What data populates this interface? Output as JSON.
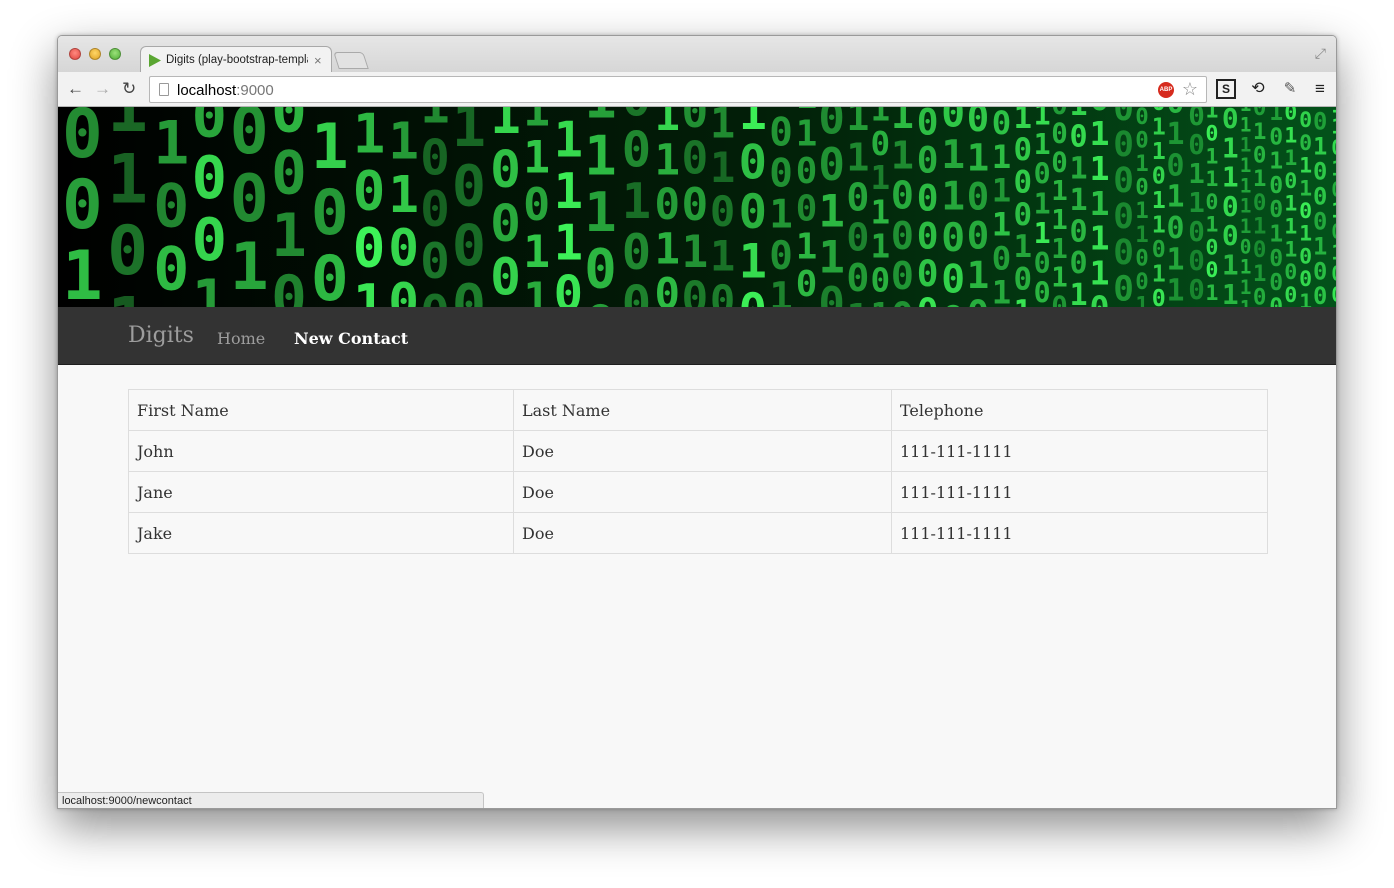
{
  "browser": {
    "tab_title": "Digits (play-bootstrap-template)",
    "tab_close": "×",
    "url_host": "localhost",
    "url_port": ":9000",
    "status_url": "localhost:9000/newcontact",
    "icons": {
      "back": "arrow-left-icon",
      "forward": "arrow-right-icon",
      "reload": "reload-icon",
      "page": "page-icon",
      "adblock": "adblock-icon",
      "bookmark": "star-icon",
      "menu": "hamburger-menu-icon"
    },
    "adblock_label": "ABP"
  },
  "navbar": {
    "brand": "Digits",
    "links": [
      {
        "label": "Home",
        "active": false
      },
      {
        "label": "New Contact",
        "active": true
      }
    ]
  },
  "table": {
    "headers": [
      "First Name",
      "Last Name",
      "Telephone"
    ],
    "rows": [
      [
        "John",
        "Doe",
        "111-111-1111"
      ],
      [
        "Jane",
        "Doe",
        "111-111-1111"
      ],
      [
        "Jake",
        "Doe",
        "111-111-1111"
      ]
    ]
  },
  "colors": {
    "navbar_bg": "#333333",
    "navbar_text": "#9d9d9d",
    "navbar_active": "#ffffff",
    "banner_green": "#3ef75a",
    "page_bg": "#f8f8f8"
  }
}
